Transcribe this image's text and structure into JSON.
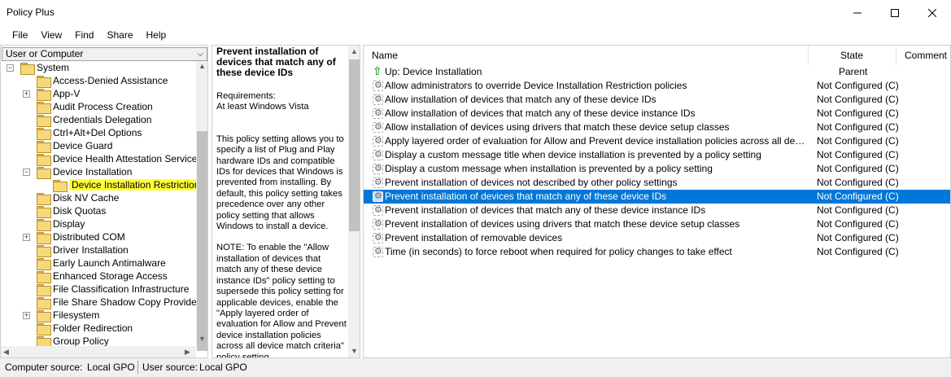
{
  "window": {
    "title": "Policy Plus"
  },
  "menu": [
    "File",
    "View",
    "Find",
    "Share",
    "Help"
  ],
  "left_panel": {
    "scope_selector": "User or Computer",
    "tree": [
      {
        "label": "System",
        "level": 0,
        "expander": "-"
      },
      {
        "label": "Access-Denied Assistance",
        "level": 1,
        "expander": ""
      },
      {
        "label": "App-V",
        "level": 1,
        "expander": "+"
      },
      {
        "label": "Audit Process Creation",
        "level": 1,
        "expander": ""
      },
      {
        "label": "Credentials Delegation",
        "level": 1,
        "expander": ""
      },
      {
        "label": "Ctrl+Alt+Del Options",
        "level": 1,
        "expander": ""
      },
      {
        "label": "Device Guard",
        "level": 1,
        "expander": ""
      },
      {
        "label": "Device Health Attestation Service",
        "level": 1,
        "expander": ""
      },
      {
        "label": "Device Installation",
        "level": 1,
        "expander": "-"
      },
      {
        "label": "Device Installation Restrictions",
        "level": 2,
        "expander": "",
        "selected": true
      },
      {
        "label": "Disk NV Cache",
        "level": 1,
        "expander": ""
      },
      {
        "label": "Disk Quotas",
        "level": 1,
        "expander": ""
      },
      {
        "label": "Display",
        "level": 1,
        "expander": ""
      },
      {
        "label": "Distributed COM",
        "level": 1,
        "expander": "+"
      },
      {
        "label": "Driver Installation",
        "level": 1,
        "expander": ""
      },
      {
        "label": "Early Launch Antimalware",
        "level": 1,
        "expander": ""
      },
      {
        "label": "Enhanced Storage Access",
        "level": 1,
        "expander": ""
      },
      {
        "label": "File Classification Infrastructure",
        "level": 1,
        "expander": ""
      },
      {
        "label": "File Share Shadow Copy Provider",
        "level": 1,
        "expander": ""
      },
      {
        "label": "Filesystem",
        "level": 1,
        "expander": "+"
      },
      {
        "label": "Folder Redirection",
        "level": 1,
        "expander": ""
      },
      {
        "label": "Group Policy",
        "level": 1,
        "expander": ""
      }
    ]
  },
  "detail_panel": {
    "heading": "Prevent installation of devices that match any of these device IDs",
    "requirements_label": "Requirements:",
    "requirements_value": "At least Windows Vista",
    "description": "This policy setting allows you to specify a list of Plug and Play hardware IDs and compatible IDs for devices that Windows is prevented from installing. By default, this policy setting takes precedence over any other policy setting that allows Windows to install a device.",
    "note": "NOTE: To enable the \"Allow installation of devices that match any of these device instance IDs\" policy setting to supersede this policy setting for applicable devices, enable the \"Apply layered order of evaluation for Allow and Prevent device installation policies across all device match criteria\" policy setting."
  },
  "list": {
    "columns": {
      "name": "Name",
      "state": "State",
      "comment": "Comment"
    },
    "up_row": {
      "name": "Up: Device Installation",
      "state": "Parent"
    },
    "rows": [
      {
        "name": "Allow administrators to override Device Installation Restriction policies",
        "state": "Not Configured (C)"
      },
      {
        "name": "Allow installation of devices that match any of these device IDs",
        "state": "Not Configured (C)"
      },
      {
        "name": "Allow installation of devices that match any of these device instance IDs",
        "state": "Not Configured (C)"
      },
      {
        "name": "Allow installation of devices using drivers that match these device setup classes",
        "state": "Not Configured (C)"
      },
      {
        "name": "Apply layered order of evaluation for Allow and Prevent device installation policies across all device match cr...",
        "state": "Not Configured (C)"
      },
      {
        "name": "Display a custom message title when device installation is prevented by a policy setting",
        "state": "Not Configured (C)"
      },
      {
        "name": "Display a custom message when installation is prevented by a policy setting",
        "state": "Not Configured (C)"
      },
      {
        "name": "Prevent installation of devices not described by other policy settings",
        "state": "Not Configured (C)"
      },
      {
        "name": "Prevent installation of devices that match any of these device IDs",
        "state": "Not Configured (C)",
        "selected": true
      },
      {
        "name": "Prevent installation of devices that match any of these device instance IDs",
        "state": "Not Configured (C)"
      },
      {
        "name": "Prevent installation of devices using drivers that match these device setup classes",
        "state": "Not Configured (C)"
      },
      {
        "name": "Prevent installation of removable devices",
        "state": "Not Configured (C)"
      },
      {
        "name": "Time (in seconds) to force reboot when required for policy changes to take effect",
        "state": "Not Configured (C)"
      }
    ]
  },
  "status": {
    "computer_source_label": "Computer source:",
    "computer_source_value": "Local GPO",
    "user_source_label": "User source:",
    "user_source_value": "Local GPO"
  },
  "colors": {
    "selection": "#0078d7",
    "tree_highlight": "#ffff3a"
  }
}
